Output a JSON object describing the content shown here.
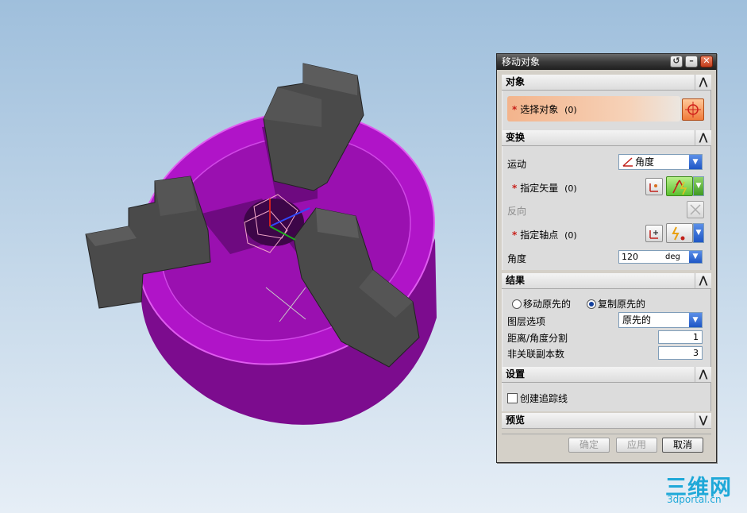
{
  "dialog": {
    "title": "移动对象",
    "sections": {
      "object": {
        "header": "对象",
        "select_object_label": "选择对象",
        "select_object_count": "(0)"
      },
      "transform": {
        "header": "变换",
        "motion_label": "运动",
        "motion_value": "角度",
        "specify_vector_label": "指定矢量",
        "specify_vector_count": "(0)",
        "reverse_label": "反向",
        "specify_axis_point_label": "指定轴点",
        "specify_axis_point_count": "(0)",
        "angle_label": "角度",
        "angle_value": "120",
        "angle_unit": "deg"
      },
      "result": {
        "header": "结果",
        "move_original_label": "移动原先的",
        "copy_original_label": "复制原先的",
        "layer_option_label": "图层选项",
        "layer_option_value": "原先的",
        "distance_angle_split_label": "距离/角度分割",
        "distance_angle_split_value": "1",
        "non_assoc_copies_label": "非关联副本数",
        "non_assoc_copies_value": "3"
      },
      "settings": {
        "header": "设置",
        "create_trace_label": "创建追踪线"
      },
      "preview": {
        "header": "预览"
      }
    },
    "buttons": {
      "ok": "确定",
      "apply": "应用",
      "cancel": "取消"
    }
  },
  "watermark": {
    "brand_cn": "三维网",
    "url": "3dportal.cn"
  },
  "colors": {
    "chuck_body": "#a30fb8",
    "jaw": "#4a4a4a",
    "required_marker": "#c8201a"
  }
}
